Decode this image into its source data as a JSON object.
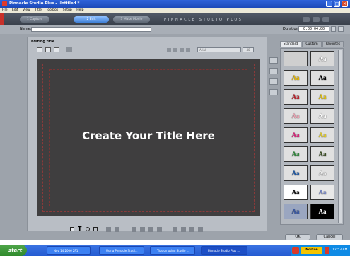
{
  "window": {
    "title": "Pinnacle Studio Plus - Untitled *"
  },
  "menu": [
    "File",
    "Edit",
    "View",
    "Title",
    "Toolbox",
    "Setup",
    "Help"
  ],
  "tabs": [
    {
      "label": "1 Capture",
      "active": false
    },
    {
      "label": "2 Edit",
      "active": true
    },
    {
      "label": "3 Make Movie",
      "active": false
    }
  ],
  "brand": "PINNACLE STUDIO PLUS",
  "name_bar": {
    "label": "Name:",
    "value": ""
  },
  "duration": {
    "label": "Duration:",
    "value": "0:00:04.00"
  },
  "editor": {
    "label": "Editing title",
    "canvas_text": "Create Your Title Here",
    "font_value": "Arial",
    "font_size": "40"
  },
  "style_tabs": [
    "Standard",
    "Custom",
    "Favorites"
  ],
  "swatches": [
    {
      "label": "",
      "fill": "#cfcfcf",
      "color": "#cfcfcf"
    },
    {
      "label": "Aa",
      "fill": "#d8d8d8",
      "color": "#ffffff"
    },
    {
      "label": "Aa",
      "fill": "#e0e0e0",
      "color": "#e6b800"
    },
    {
      "label": "Aa",
      "fill": "#e0e0e0",
      "color": "#000000"
    },
    {
      "label": "Aa",
      "fill": "#e0e0e0",
      "color": "#c0202a"
    },
    {
      "label": "Aa",
      "fill": "#e0e0e0",
      "color": "#e6c400"
    },
    {
      "label": "Aa",
      "fill": "#e0e0e0",
      "color": "#f0a5b5"
    },
    {
      "label": "Aa",
      "fill": "#e0e0e0",
      "color": "#ffffff"
    },
    {
      "label": "Aa",
      "fill": "#e0e0e0",
      "color": "#e0207a"
    },
    {
      "label": "Aa",
      "fill": "#e0e0e0",
      "color": "#e8d020"
    },
    {
      "label": "Aa",
      "fill": "#e0e0e0",
      "color": "#2e8b3a"
    },
    {
      "label": "Aa",
      "fill": "#e0e0e0",
      "color": "#3a4f20"
    },
    {
      "label": "Aa",
      "fill": "#e0e0e0",
      "color": "#1e5aa8"
    },
    {
      "label": "Aa",
      "fill": "#e0e0e0",
      "color": "#f0f0f0"
    },
    {
      "label": "Aa",
      "fill": "#ffffff",
      "color": "#111111"
    },
    {
      "label": "Aa",
      "fill": "#e8e8e8",
      "color": "#7a8bd0"
    },
    {
      "label": "Aa",
      "fill": "#9aa6c0",
      "color": "#3a5aa8"
    },
    {
      "label": "Aa",
      "fill": "#000000",
      "color": "#ffffff"
    }
  ],
  "buttons": {
    "ok": "OK",
    "cancel": "Cancel"
  },
  "taskbar": {
    "start": "start",
    "tasks": [
      "Nov 14 2006 2P1",
      "Using Pinnacle Studi...",
      "Tips on using Studio ...",
      "Pinnacle Studio Plus ..."
    ],
    "norton": "Norton",
    "clock": "12:53 AM"
  },
  "colors": {
    "accent": "#3f7fd6",
    "taskbar": "#245bd1",
    "start": "#2f8a2b"
  }
}
